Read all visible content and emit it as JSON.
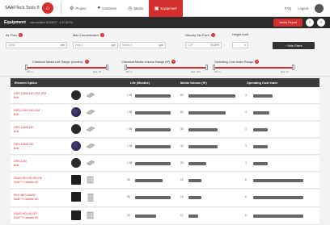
{
  "nav": {
    "brand": "SAAFTech Tools ®",
    "items": [
      {
        "label": "Project",
        "icon": "gear-icon"
      },
      {
        "label": "Customer",
        "icon": "person-icon"
      },
      {
        "label": "Media",
        "icon": "clock-icon"
      },
      {
        "label": "Equipment",
        "icon": "equipment-icon"
      }
    ],
    "faq": "FAQ",
    "logout": "Logout"
  },
  "header": {
    "title": "Equipment",
    "subtitle": "Last modified 10/5/2017 - 4:22:38 PM",
    "media_report": "Media Report"
  },
  "filters": {
    "airflow": {
      "label": "Air Flow",
      "placeholder": "10000",
      "unit": "cfm"
    },
    "max_concentration": {
      "label": "Max Concentration",
      "peak_label": "Peak",
      "peak_value": "0",
      "peak_unit": "ppb",
      "steady_label": "Steady",
      "steady_value": "0",
      "steady_unit": "ppb"
    },
    "velocity": {
      "label": "Velocity Set Point",
      "value": "1.00",
      "unit": "00.00%"
    },
    "height": {
      "label": "Height Limit",
      "value": "- -"
    },
    "hide_filters": "Hide Filters",
    "sliders": [
      {
        "label": "Chemical Media Life Range (months)",
        "min": "Min: 0",
        "max": "Max: 36"
      },
      {
        "label": "Chemical Media Volume Range (ft³)",
        "min": "Min: 0",
        "max": "Max: 200"
      },
      {
        "label": "Operating Cost Index Range",
        "min": "Min: 0",
        "max": "Max: 10"
      }
    ]
  },
  "table": {
    "columns": [
      "Element Option",
      "Life (Months)",
      "Media Volume (ft³)",
      "Operating Cost Index"
    ],
    "rows": [
      {
        "name": "DRS-12M/12M-12M-12M",
        "sub": "Bulk",
        "life": "> 36",
        "volume": "80",
        "cost": "3"
      },
      {
        "name": "DRS-12M/12M-12M",
        "sub": "Bulk",
        "life": "> 36",
        "volume": "60",
        "cost": "3"
      },
      {
        "name": "DRS-12M/12M",
        "sub": "Bulk",
        "life": "> 36",
        "volume": "40",
        "cost": "3"
      },
      {
        "name": "DRS-12M/12M",
        "sub": "Bulk",
        "life": "> 36",
        "volume": "40",
        "cost": "3"
      },
      {
        "name": "DRS-12M",
        "sub": "Bulk",
        "life": "> 36",
        "volume": "20",
        "cost": "3"
      },
      {
        "name": "SAAS-HD-HD-HD-HD",
        "sub": "SAAF™ Cassette HD",
        "life": "28",
        "volume": "16",
        "cost": "6"
      },
      {
        "name": "PKG-BE3-AW/W",
        "sub": "SAAF™ Cassette HD",
        "life": "36",
        "volume": "16",
        "cost": "6"
      },
      {
        "name": "SAAS-HD-HD-HD",
        "sub": "SAAF™ Cassette HD",
        "life": "20",
        "volume": "12",
        "cost": "6"
      }
    ]
  }
}
